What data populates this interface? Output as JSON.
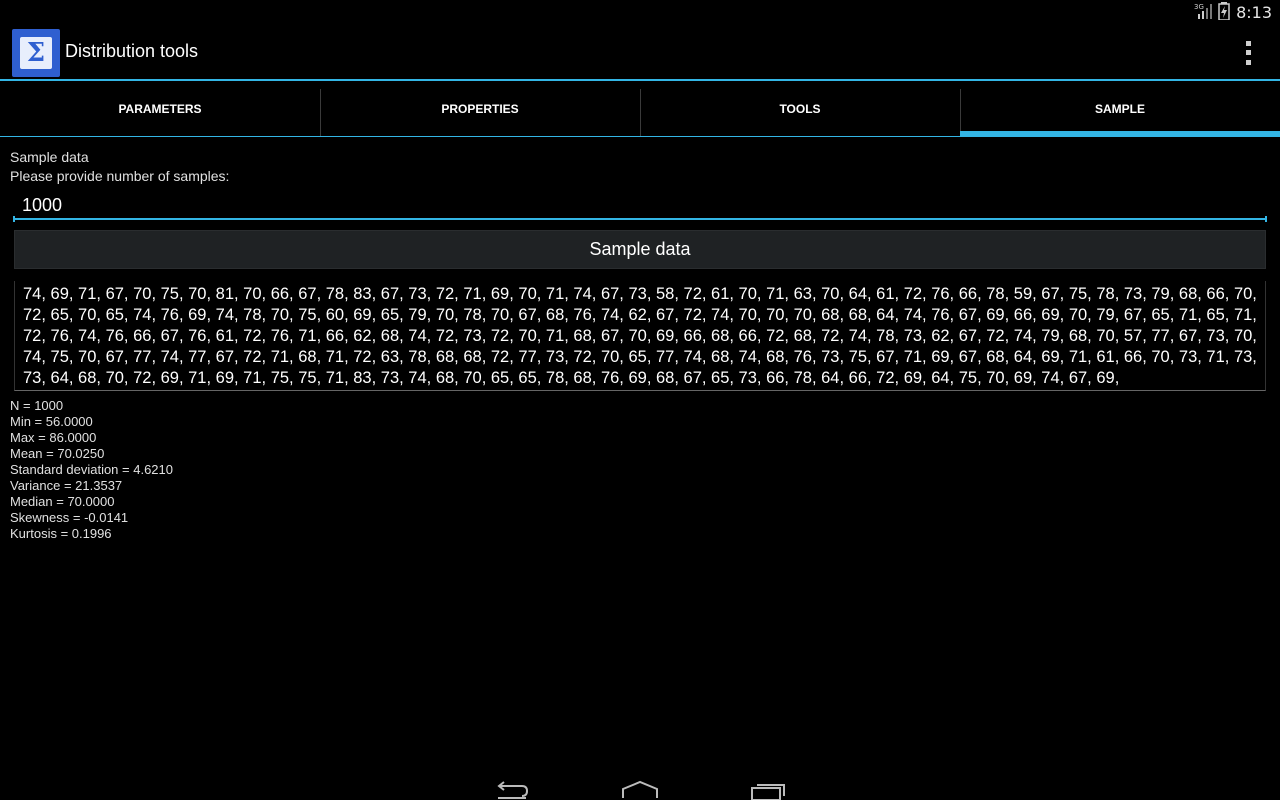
{
  "status": {
    "time": "8:13",
    "network": "3G"
  },
  "app": {
    "title": "Distribution tools",
    "icon": "sigma-icon"
  },
  "tabs": [
    {
      "label": "PARAMETERS",
      "selected": false
    },
    {
      "label": "PROPERTIES",
      "selected": false
    },
    {
      "label": "TOOLS",
      "selected": false
    },
    {
      "label": "SAMPLE",
      "selected": true
    }
  ],
  "sample": {
    "heading": "Sample data",
    "prompt": "Please provide number of samples:",
    "count_value": "1000",
    "button_label": "Sample data",
    "values_text": "74, 69, 71, 67, 70, 75, 70, 81, 70, 66, 67, 78, 83, 67, 73, 72, 71, 69, 70, 71, 74, 67, 73, 58, 72, 61, 70, 71, 63, 70, 64, 61, 72, 76, 66, 78, 59, 67, 75, 78, 73, 79, 68, 66, 70, 72, 65, 70, 65, 74, 76, 69, 74, 78, 70, 75, 60, 69, 65, 79, 70, 78, 70, 67, 68, 76, 74, 62, 67, 72, 74, 70, 70, 70, 68, 68, 64, 74, 76, 67, 69, 66, 69, 70, 79, 67, 65, 71, 65, 71, 72, 76, 74, 76, 66, 67, 76, 61, 72, 76, 71, 66, 62, 68, 74, 72, 73, 72, 70, 71, 68, 67, 70, 69, 66, 68, 66, 72, 68, 72, 74, 78, 73, 62, 67, 72, 74, 79, 68, 70, 57, 77, 67, 73, 70, 74, 75, 70, 67, 77, 74, 77, 67, 72, 71, 68, 71, 72, 63, 78, 68, 68, 72, 77, 73, 72, 70, 65, 77, 74, 68, 74, 68, 76, 73, 75, 67, 71, 69, 67, 68, 64, 69, 71, 61, 66, 70, 73, 71, 73, 73, 64, 68, 70, 72, 69, 71, 69, 71, 75, 75, 71, 83, 73, 74, 68, 70, 65, 65, 78, 68, 76, 69, 68, 67, 65, 73, 66, 78, 64, 66, 72, 69, 64, 75, 70, 69, 74, 67, 69,"
  },
  "stats": [
    "N = 1000",
    "Min = 56.0000",
    "Max = 86.0000",
    "Mean = 70.0250",
    "Standard deviation = 4.6210",
    "Variance = 21.3537",
    "Median = 70.0000",
    "Skewness = -0.0141",
    "Kurtosis = 0.1996"
  ],
  "colors": {
    "accent": "#33b5e5",
    "background": "#000000",
    "app_icon": "#2f5fd0"
  }
}
